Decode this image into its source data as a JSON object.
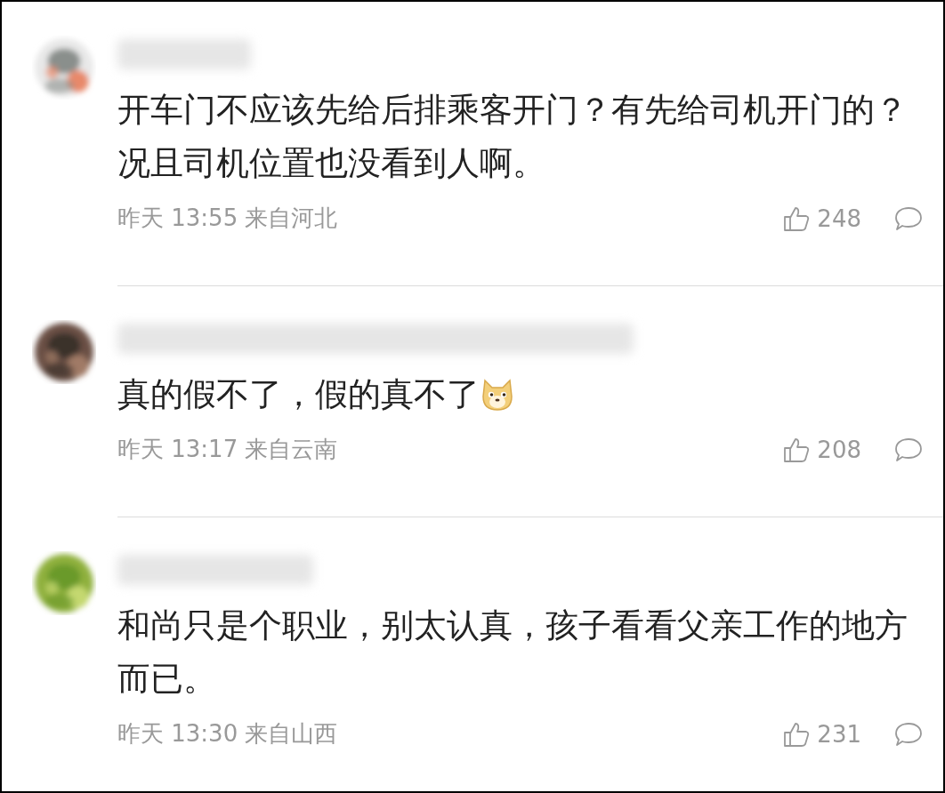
{
  "comments": [
    {
      "text": "开车门不应该先给后排乘客开门？有先给司机开门的？况且司机位置也没看到人啊。",
      "meta": "昨天 13:55 来自河北",
      "likes": "248",
      "emoji": false
    },
    {
      "text": "真的假不了，假的真不了",
      "meta": "昨天 13:17 来自云南",
      "likes": "208",
      "emoji": true
    },
    {
      "text": "和尚只是个职业，别太认真，孩子看看父亲工作的地方而已。",
      "meta": "昨天 13:30 来自山西",
      "likes": "231",
      "emoji": false
    }
  ]
}
